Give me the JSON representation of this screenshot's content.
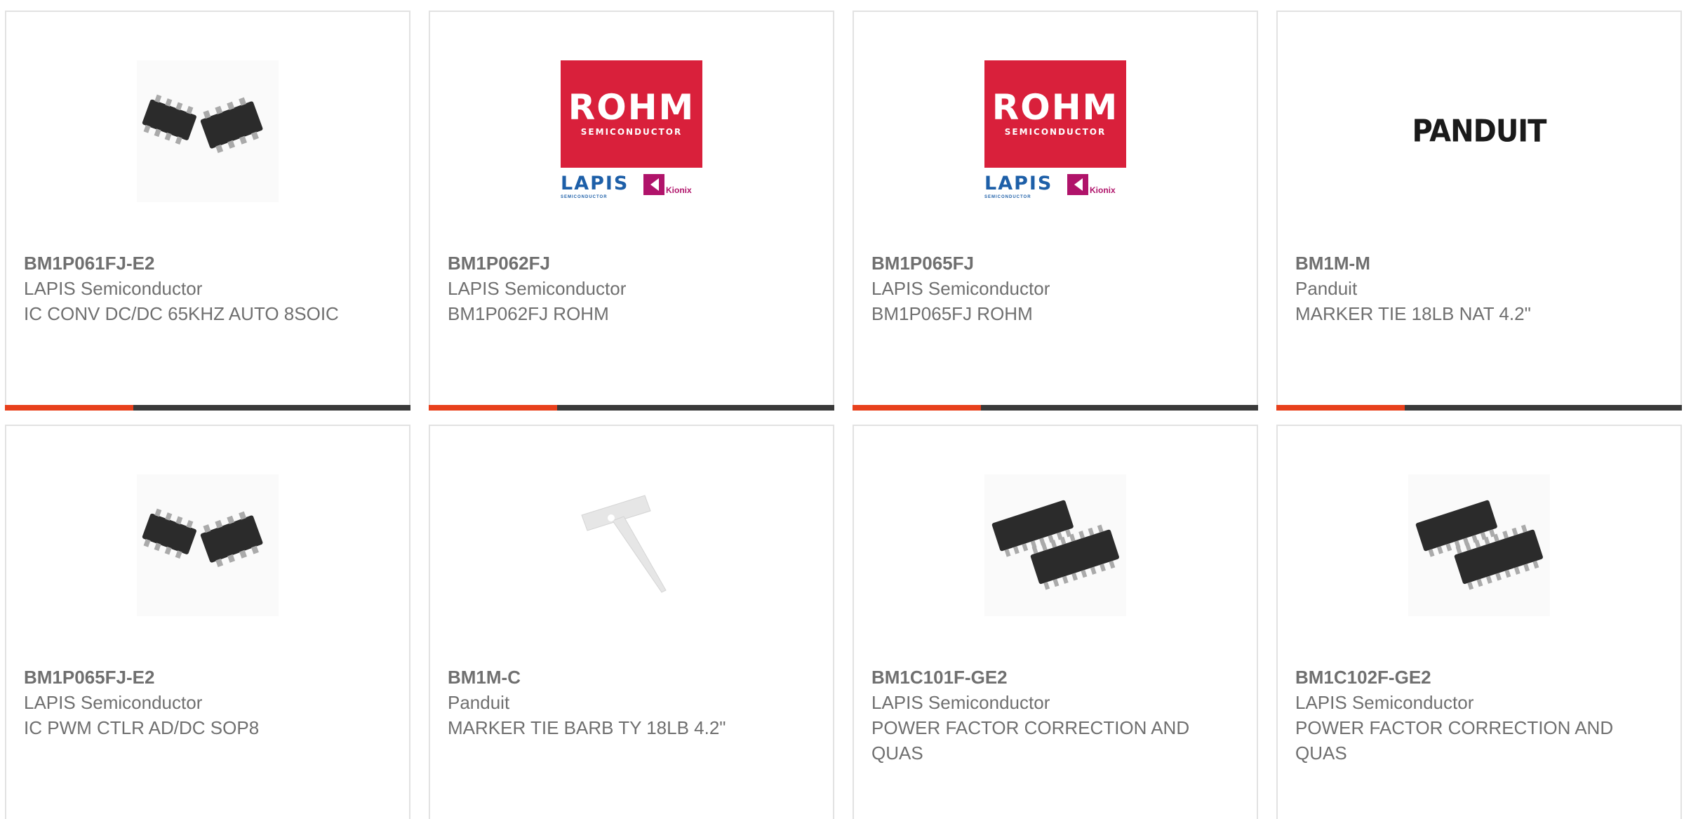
{
  "products": [
    {
      "part_number": "BM1P061FJ-E2",
      "manufacturer": "LAPIS Semiconductor",
      "description": "IC CONV DC/DC 65KHZ AUTO 8SOIC",
      "image": "soic8-chips-icon"
    },
    {
      "part_number": "BM1P062FJ",
      "manufacturer": "LAPIS Semiconductor",
      "description": "BM1P062FJ ROHM",
      "image": "rohm-lapis-logo"
    },
    {
      "part_number": "BM1P065FJ",
      "manufacturer": "LAPIS Semiconductor",
      "description": "BM1P065FJ ROHM",
      "image": "rohm-lapis-logo"
    },
    {
      "part_number": "BM1M-M",
      "manufacturer": "Panduit",
      "description": "MARKER TIE 18LB NAT 4.2\"",
      "image": "panduit-logo"
    },
    {
      "part_number": "BM1P065FJ-E2",
      "manufacturer": "LAPIS Semiconductor",
      "description": "IC PWM CTLR AD/DC SOP8",
      "image": "soic8-chips-icon"
    },
    {
      "part_number": "BM1M-C",
      "manufacturer": "Panduit",
      "description": "MARKER TIE BARB TY 18LB 4.2\"",
      "image": "marker-tie-icon"
    },
    {
      "part_number": "BM1C101F-GE2",
      "manufacturer": "LAPIS Semiconductor",
      "description": "POWER FACTOR CORRECTION AND QUAS",
      "image": "soic16-chips-icon"
    },
    {
      "part_number": "BM1C102F-GE2",
      "manufacturer": "LAPIS Semiconductor",
      "description": "POWER FACTOR CORRECTION AND QUAS",
      "image": "soic16-chips-icon"
    }
  ],
  "logos": {
    "rohm_word": "ROHM",
    "rohm_sub": "SEMICONDUCTOR",
    "lapis_word": "LAPIS",
    "lapis_sub": "SEMICONDUCTOR",
    "kionix_word": "Kionix",
    "panduit_word": "PANDUIT"
  },
  "colors": {
    "accent": "#e8401c",
    "bar_dark": "#3a3a3a",
    "rohm_red": "#d9203b",
    "lapis_blue": "#1d5fa8",
    "kionix_magenta": "#b0136a",
    "text_gray": "#6f6f6f",
    "card_border": "#e2e2e2"
  }
}
